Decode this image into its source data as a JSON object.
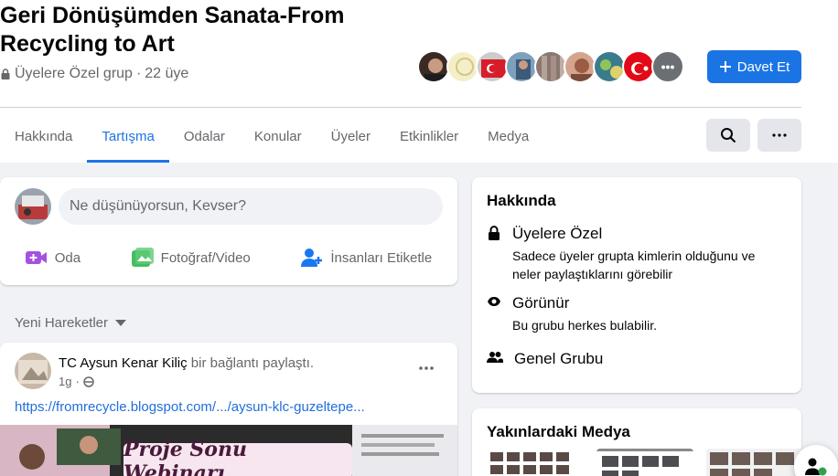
{
  "group": {
    "title": "Geri Dönüşümden Sanata-From Recycling to Art",
    "privacy": "Üyelere Özel grup",
    "separator": "·",
    "members": "22 üye"
  },
  "invite_label": "Davet Et",
  "tabs": [
    "Hakkında",
    "Tartışma",
    "Odalar",
    "Konular",
    "Üyeler",
    "Etkinlikler",
    "Medya"
  ],
  "composer": {
    "placeholder": "Ne düşünüyorsun, Kevser?",
    "actions": [
      "Oda",
      "Fotoğraf/Video",
      "İnsanları Etiketle"
    ]
  },
  "recent_label": "Yeni Hareketler",
  "post": {
    "author": "TC Aysun Kenar Kiliç",
    "action": "bir bağlantı paylaştı.",
    "time": "1g",
    "link": "https://fromrecycle.blogspot.com/.../aysun-klc-guzeltepe...",
    "media_text": "Proje Sonu Webinarı"
  },
  "about": {
    "heading": "Hakkında",
    "private_title": "Üyelere Özel",
    "private_desc": "Sadece üyeler grupta kimlerin olduğunu ve neler paylaştıklarını görebilir",
    "visible_title": "Görünür",
    "visible_desc": "Bu grubu herkes bulabilir.",
    "general_title": "Genel Grubu"
  },
  "media_heading": "Yakınlardaki Medya",
  "avatar_more": "•••",
  "colors": {
    "accent": "#1b74e4",
    "link": "#216fdb",
    "muted": "#65676b"
  }
}
